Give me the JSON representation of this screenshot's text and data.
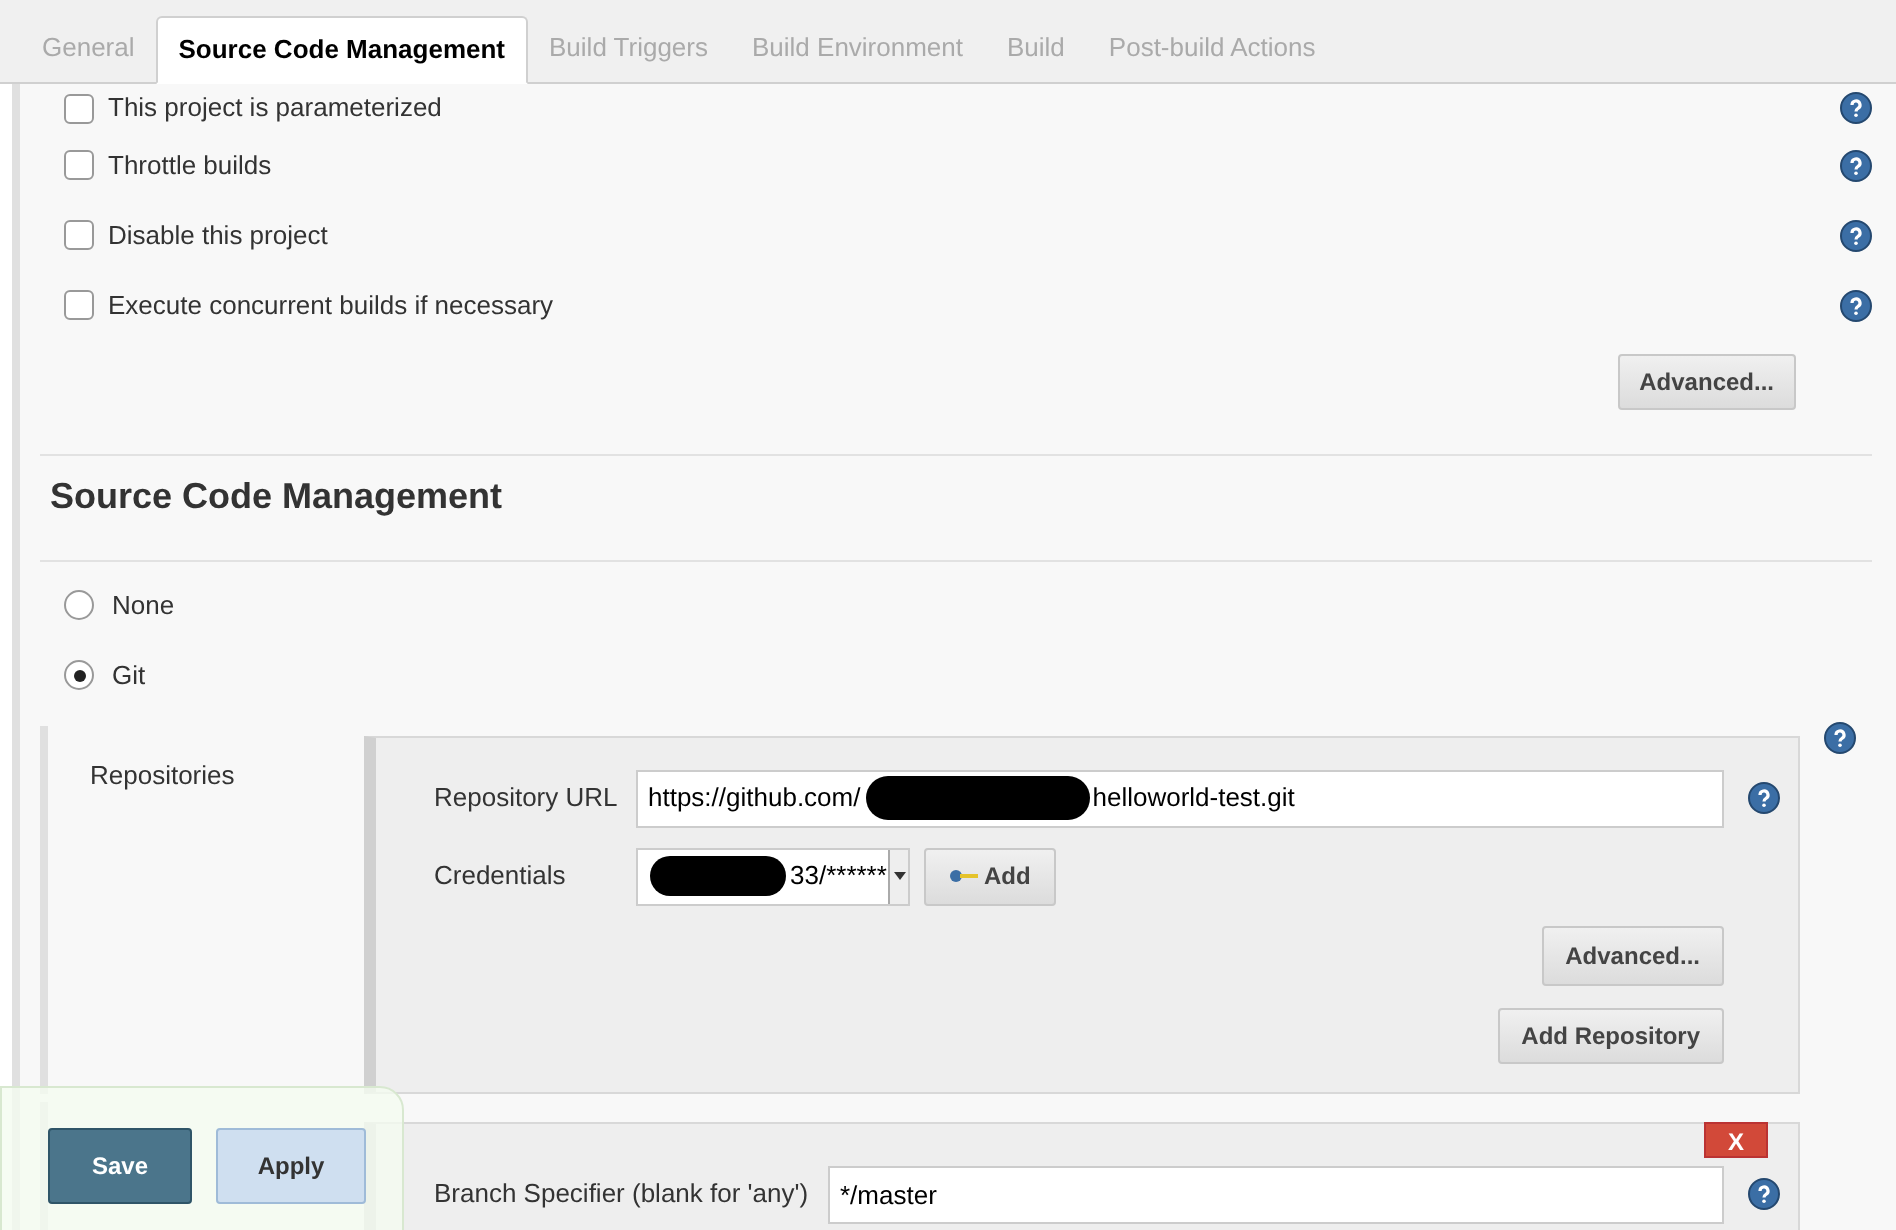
{
  "tabs": [
    {
      "label": "General",
      "selected": false
    },
    {
      "label": "Source Code Management",
      "selected": true
    },
    {
      "label": "Build Triggers",
      "selected": false
    },
    {
      "label": "Build Environment",
      "selected": false
    },
    {
      "label": "Build",
      "selected": false
    },
    {
      "label": "Post-build Actions",
      "selected": false
    }
  ],
  "options": [
    {
      "label": "This project is parameterized",
      "checked": false
    },
    {
      "label": "Throttle builds",
      "checked": false
    },
    {
      "label": "Disable this project",
      "checked": false
    },
    {
      "label": "Execute concurrent builds if necessary",
      "checked": false
    }
  ],
  "advanced_button": "Advanced...",
  "section_title": "Source Code Management",
  "scm_choices": [
    {
      "label": "None",
      "selected": false
    },
    {
      "label": "Git",
      "selected": true
    }
  ],
  "repositories": {
    "label": "Repositories",
    "url_label": "Repository URL",
    "url_start": "https://github.com/",
    "url_end": "helloworld-test.git",
    "credentials_label": "Credentials",
    "credentials_value": "33/******",
    "add_button": "Add",
    "advanced_button": "Advanced...",
    "add_repository_button": "Add Repository"
  },
  "branches": {
    "delete_button": "X",
    "specifier_label": "Branch Specifier (blank for 'any')",
    "specifier_value": "*/master"
  },
  "footer_buttons": [
    "Save",
    "Apply"
  ]
}
